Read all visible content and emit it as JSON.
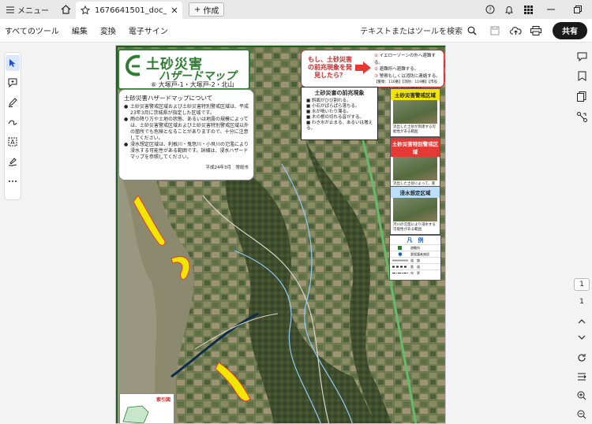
{
  "titlebar": {
    "menu_label": "メニュー",
    "tab_title": "1676641501_doc_3_...",
    "new_tab_label": "作成"
  },
  "toolbar": {
    "all_tools": "すべてのツール",
    "edit": "編集",
    "convert": "変換",
    "e_sign": "電子サイン",
    "search_placeholder": "テキストまたはツールを検索",
    "share": "共有"
  },
  "document": {
    "title_main": "土砂災害",
    "title_sub": "ハザードマップ",
    "title_area": "⑥ 大塚戸-1・大塚戸-2・北山",
    "warning_question": "もし、土砂災害の前兆現象を発見したら？",
    "warning_items": [
      {
        "num": "①",
        "text": "イエローゾーンの外へ避難する。"
      },
      {
        "num": "②",
        "text": "避難所へ避難する。"
      },
      {
        "num": "③",
        "text": "警察もしくは消防に連絡する。"
      }
    ],
    "warning_phone": "【警察：110番】【消防：119番】【市役所：0297−23−2111(代表)】",
    "info_title": "土砂災害ハザードマップについて",
    "info_paragraphs": [
      "土砂災害警戒区域および土砂災害特別警戒区域は、平成23年3月に茨城県が指定した区域です。",
      "雨の降り方や土地の状態、あるいは地震の規模によっては、土砂災害警戒区域および土砂災害特別警戒区域以外の箇所でも危険となることがありますので、十分に注意してください。",
      "浸水想定区域は、利根川・鬼怒川・小貝川の氾濫により浸水する可能性がある範囲です。詳細は、浸水ハザードマップを参照してください。"
    ],
    "info_date": "平成24年3月　常総市",
    "signs_title": "土砂災害の前兆現象",
    "signs": [
      "斜面がひび割れる。",
      "小石がぱらぱら落ちる。",
      "水が噴いたり濁る。",
      "木の根の切れる音がする。",
      "わき水が止まる、あるいは増える。"
    ],
    "zones": [
      {
        "title": "土砂災害警戒区域",
        "caption": "流出した土砂が到達する可能性がある範囲",
        "color": "#f2e600"
      },
      {
        "title": "土砂災害特別警戒区域",
        "caption": "流出した土砂によって、家屋が被害をうける可能性がある範囲",
        "color": "#e53935"
      },
      {
        "title": "浸水想定区域",
        "caption": "河川の氾濫により浸水する可能性がある範囲",
        "color": "#42a5f5"
      }
    ],
    "legend_title": "凡　例",
    "legend_items": [
      "避難所",
      "要援護者施設",
      "道　路",
      "鉄　道",
      "市　界"
    ],
    "index_title": "索引図"
  },
  "right_rail": {
    "page_current": "1",
    "page_total": "1"
  },
  "colors": {
    "accent_green": "#2e7d32",
    "warning_red": "#c62828",
    "share_button": "#1a1a1a",
    "active_tool": "#dbe7fb"
  }
}
